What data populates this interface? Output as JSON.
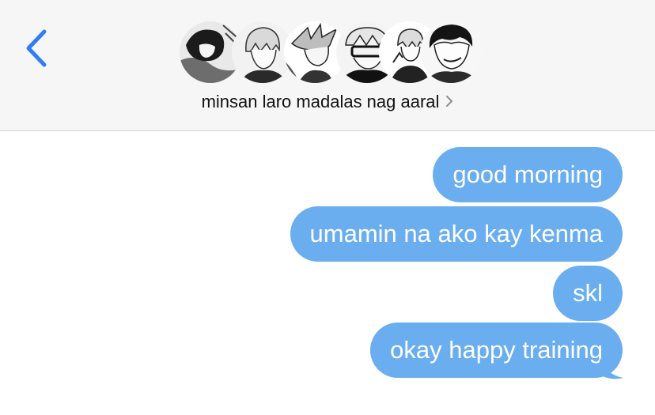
{
  "header": {
    "group_name": "minsan laro madalas nag aaral",
    "avatar_count": 6
  },
  "icons": {
    "back": "chevron-left-icon",
    "details": "chevron-right-icon"
  },
  "colors": {
    "header_bg": "#f6f6f6",
    "accent": "#2f7cf6",
    "bubble": "#6aaef0",
    "bubble_text": "#ffffff"
  },
  "messages": [
    {
      "text": "good morning",
      "direction": "outgoing"
    },
    {
      "text": "umamin na ako kay kenma",
      "direction": "outgoing"
    },
    {
      "text": "skl",
      "direction": "outgoing"
    },
    {
      "text": "okay happy training",
      "direction": "outgoing"
    }
  ]
}
